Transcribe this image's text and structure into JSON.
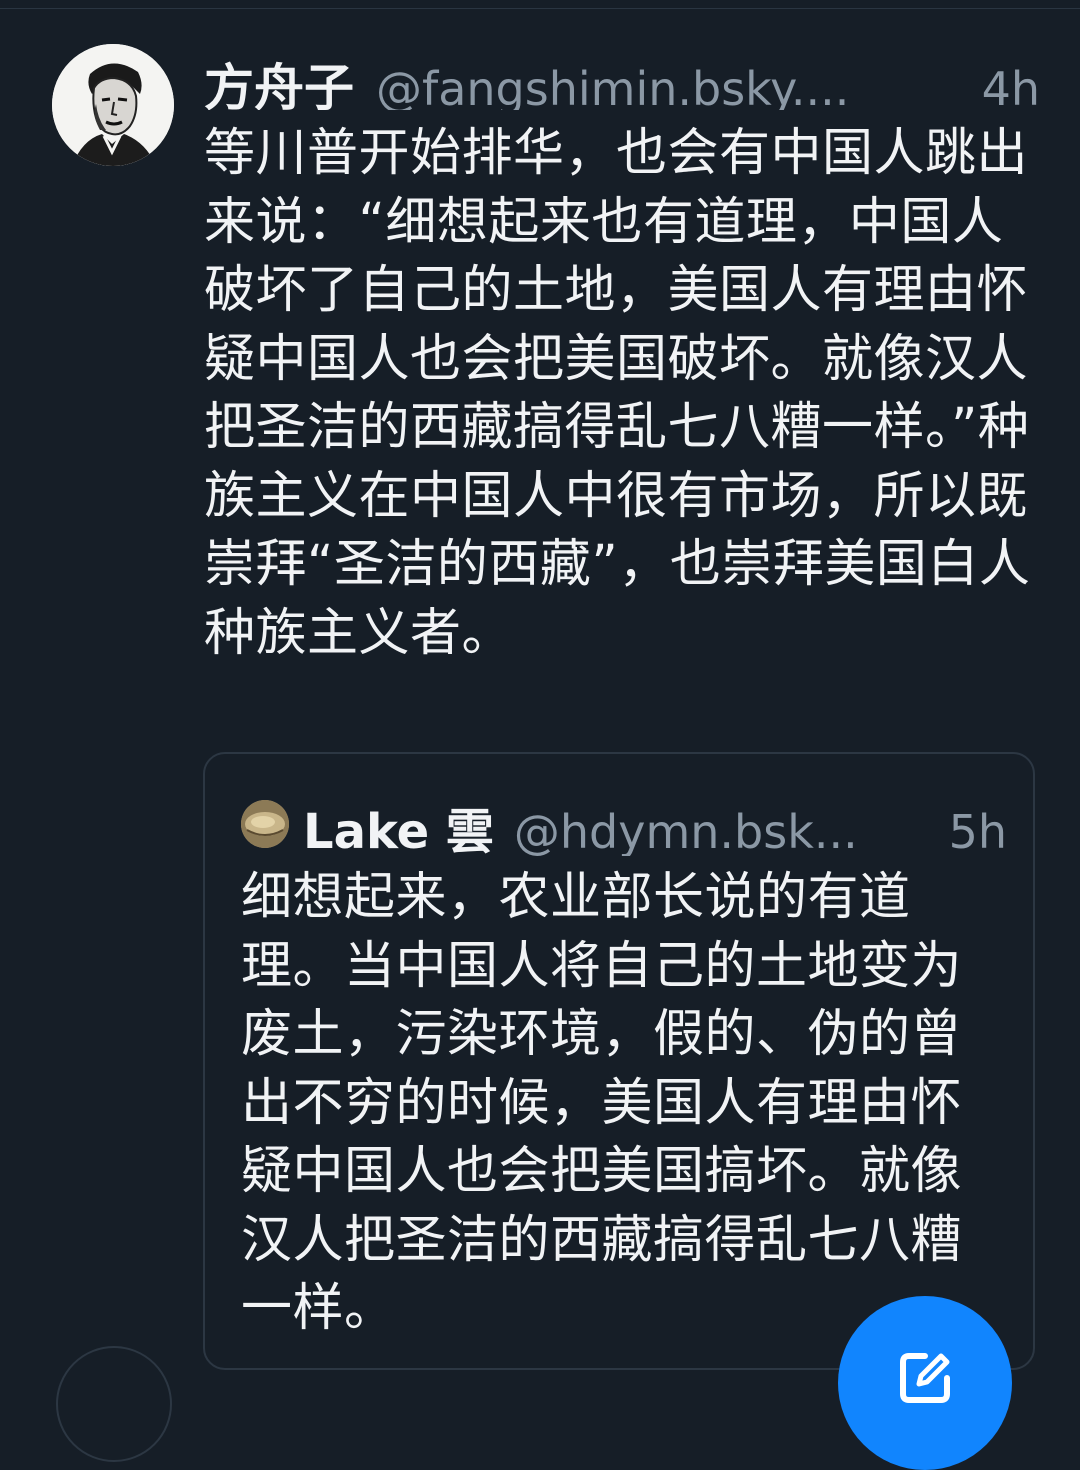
{
  "post": {
    "display_name": "方舟子",
    "handle": "@fangshimin.bsky....",
    "time": "4h",
    "text": "等川普开始排华，也会有中国人跳出来说：“细想起来也有道理，中国人破坏了自己的土地，美国人有理由怀疑中国人也会把美国破坏。就像汉人把圣洁的西藏搞得乱七八糟一样。”种族主义在中国人中很有市场，所以既崇拜“圣洁的西藏”，也崇拜美国白人种族主义者。"
  },
  "quote": {
    "display_name": "Lake 雲",
    "handle": "@hdymn.bsk...",
    "time": "5h",
    "text": "细想起来，农业部长说的有道理。当中国人将自己的土地变为废土，污染环境，假的、伪的曾出不穷的时候，美国人有理由怀疑中国人也会把美国搞坏。就像汉人把圣洁的西藏搞得乱七八糟一样。"
  },
  "icons": {
    "author_avatar": "author-avatar",
    "quote_avatar": "quote-author-avatar",
    "compose": "compose-icon"
  },
  "colors": {
    "background": "#161e27",
    "text_primary": "#f1f3f5",
    "text_secondary": "#8b98a5",
    "accent": "#1185fe",
    "border": "#2c3743"
  }
}
